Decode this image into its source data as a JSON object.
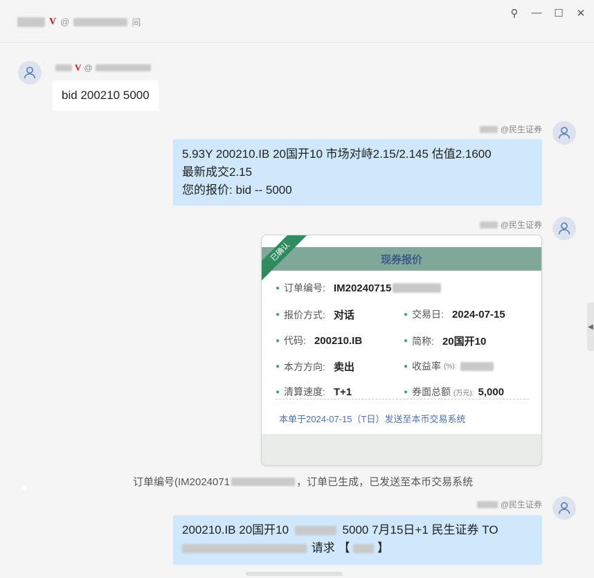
{
  "titlebar": {
    "v_mark": "V",
    "at_prefix": "@",
    "name_suffix": "间"
  },
  "window_controls": {
    "pin": "⚲",
    "minimize": "—",
    "maximize": "☐",
    "close": "✕"
  },
  "messages": [
    {
      "side": "left",
      "sender_v": "V",
      "sender_at": "@",
      "text": "bid 200210 5000"
    },
    {
      "side": "right",
      "sender_org": "@民生证券",
      "lines": [
        "5.93Y 200210.IB 20国开10 市场对峙2.15/2.145 估值2.1600",
        "最新成交2.15",
        "您的报价: bid -- 5000"
      ]
    },
    {
      "side": "right",
      "sender_org": "@民生证券"
    },
    {
      "side": "right",
      "sender_org": "@民生证券",
      "line1_a": "200210.IB 20国开10",
      "line1_b": "5000 7月15日+1 民生证券 TO",
      "line2_a": "请求 【",
      "line2_b": "】"
    }
  ],
  "quote_card": {
    "ribbon": "已确认",
    "title": "现券报价",
    "order_no_label": "订单编号:",
    "order_no_value": "IM20240715",
    "quote_method_label": "报价方式:",
    "quote_method_value": "对话",
    "trade_date_label": "交易日:",
    "trade_date_value": "2024-07-15",
    "code_label": "代码:",
    "code_value": "200210.IB",
    "short_name_label": "简称:",
    "short_name_value": "20国开10",
    "direction_label": "本方方向:",
    "direction_value": "卖出",
    "yield_label": "收益率",
    "yield_unit": "(%):",
    "settle_label": "清算速度:",
    "settle_value": "T+1",
    "face_label": "券面总额",
    "face_unit": "(万元):",
    "face_value": "5,000",
    "note": "本单于2024-07-15（T日）发送至本币交易系统"
  },
  "system_message": {
    "prefix": "订单编号(IM2024071",
    "suffix": "，订单已生成，已发送至本币交易系统"
  },
  "side_tab": "◀",
  "left_arrow": "◀"
}
